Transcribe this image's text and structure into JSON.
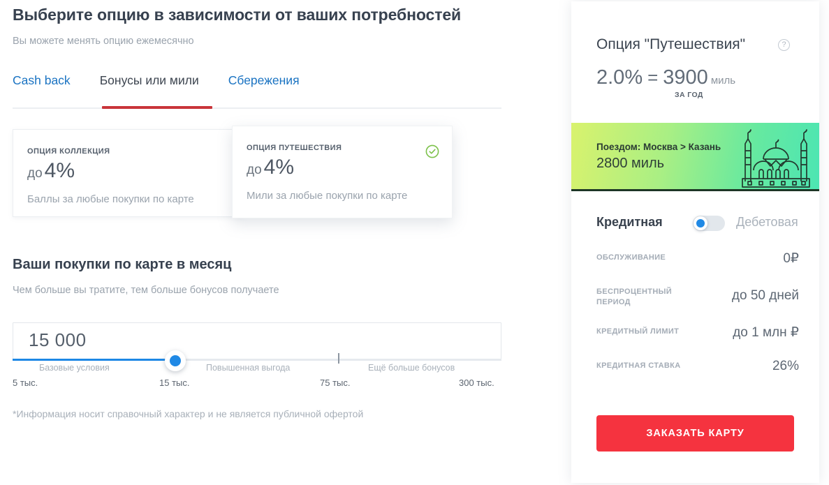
{
  "header": {
    "title": "Выберите опцию в зависимости от ваших потребностей",
    "subtitle": "Вы можете менять опцию ежемесячно"
  },
  "tabs": [
    {
      "label": "Cash back",
      "active": false
    },
    {
      "label": "Бонусы или мили",
      "active": true
    },
    {
      "label": "Сбережения",
      "active": false
    }
  ],
  "option_cards": [
    {
      "kicker": "ОПЦИЯ КОЛЛЕКЦИЯ",
      "rate_prefix": "до",
      "rate_value": "4%",
      "description": "Баллы за любые покупки по карте",
      "selected": false
    },
    {
      "kicker": "ОПЦИЯ ПУТЕШЕСТВИЯ",
      "rate_prefix": "до",
      "rate_value": "4%",
      "description": "Мили за любые покупки по карте",
      "selected": true
    }
  ],
  "purchases": {
    "title": "Ваши покупки по карте в месяц",
    "subtitle": "Чем больше вы тратите, тем больше бонусов получаете",
    "value": "15 000",
    "zones": [
      "Базовые условия",
      "Повышенная выгода",
      "Ещё больше бонусов"
    ],
    "scale": [
      "5 тыс.",
      "15 тыс.",
      "75 тыс.",
      "300 тыс."
    ]
  },
  "footnote": "*Информация носит справочный характер и не является публичной офертой",
  "right_panel": {
    "title": "Опция \"Путешествия\"",
    "help_glyph": "?",
    "rate": {
      "percent": "2.0%",
      "equals": "=",
      "amount": "3900",
      "unit": "миль",
      "period": "ЗА ГОД"
    },
    "banner": {
      "route": "Поездом: Москва > Казань",
      "miles": "2800 миль"
    },
    "toggle": {
      "left_label": "Кредитная",
      "right_label": "Дебетовая",
      "state": "left"
    },
    "specs": [
      {
        "key": "ОБСЛУЖИВАНИЕ",
        "value": "0₽"
      },
      {
        "key": "БЕСПРОЦЕНТНЫЙ ПЕРИОД",
        "value": "до 50 дней"
      },
      {
        "key": "КРЕДИТНЫЙ ЛИМИТ",
        "value": "до 1 млн ₽"
      },
      {
        "key": "КРЕДИТНАЯ СТАВКА",
        "value": "26%"
      }
    ],
    "order_button": "ЗАКАЗАТЬ КАРТУ"
  },
  "colors": {
    "accent_blue": "#1a73c2",
    "tab_underline": "#c9353a",
    "slider_blue": "#2089e5",
    "order_red": "#f5333f",
    "check_green": "#7cc14a"
  }
}
